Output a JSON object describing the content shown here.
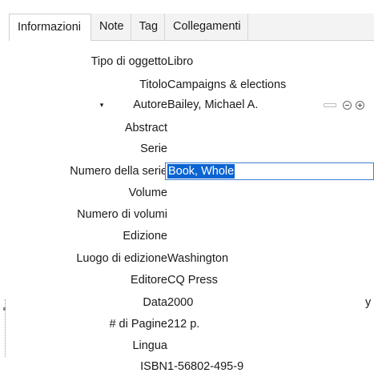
{
  "tabs": [
    {
      "label": "Informazioni",
      "active": true
    },
    {
      "label": "Note",
      "active": false
    },
    {
      "label": "Tag",
      "active": false
    },
    {
      "label": "Collegamenti",
      "active": false
    }
  ],
  "fields": {
    "item_type": {
      "label": "Tipo di oggetto",
      "value": "Libro"
    },
    "title": {
      "label": "Titolo",
      "value": "Campaigns & elections"
    },
    "author": {
      "label": "Autore",
      "value": "Bailey, Michael A.",
      "toggle_glyph": "▾"
    },
    "abstract": {
      "label": "Abstract",
      "value": ""
    },
    "series": {
      "label": "Serie",
      "value": ""
    },
    "series_number": {
      "label": "Numero della serie",
      "value": "Book, Whole"
    },
    "volume": {
      "label": "Volume",
      "value": ""
    },
    "num_volumes": {
      "label": "Numero di volumi",
      "value": ""
    },
    "edition": {
      "label": "Edizione",
      "value": ""
    },
    "place": {
      "label": "Luogo di edizione",
      "value": "Washington"
    },
    "publisher": {
      "label": "Editore",
      "value": "CQ Press"
    },
    "date": {
      "label": "Data",
      "value": "2000",
      "right_fragment": "y"
    },
    "pages": {
      "label": "# di Pagine",
      "value": "212 p."
    },
    "language": {
      "label": "Lingua",
      "value": ""
    },
    "isbn": {
      "label": "ISBN",
      "value": "1-56802-495-9"
    }
  },
  "icons": {
    "author_toggle": "chevron-down-icon",
    "swap_name": "swap-name-format-icon",
    "remove_creator": "minus-circle-icon",
    "add_creator": "plus-circle-icon"
  },
  "colors": {
    "selection": "#0a64d2",
    "focus_border": "#3c7fd6",
    "tab_strip": "#f3f3f3"
  }
}
